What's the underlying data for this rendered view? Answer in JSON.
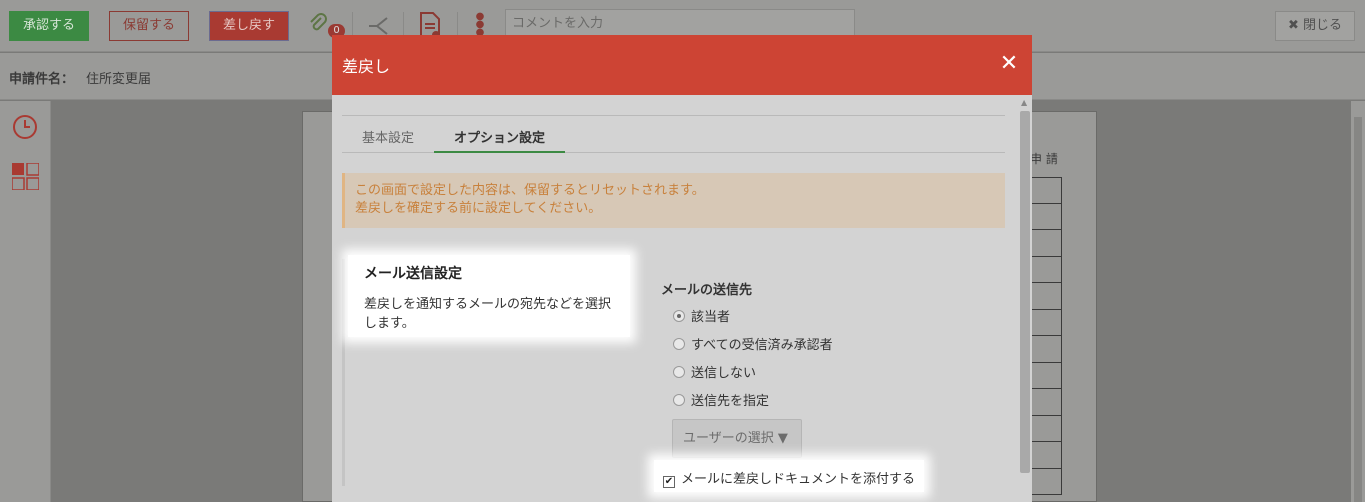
{
  "toolbar": {
    "approve_label": "承認する",
    "hold_label": "保留する",
    "return_label": "差し戻す",
    "attachment_count": "0",
    "comment_placeholder": "コメントを入力",
    "close_label": "閉じる"
  },
  "appbar": {
    "label": "申請件名：",
    "value": "住所変更届"
  },
  "paper": {
    "header_text": "申 請"
  },
  "modal": {
    "title": "差戻し",
    "tabs": [
      {
        "label": "基本設定",
        "active": false
      },
      {
        "label": "オプション設定",
        "active": true
      }
    ],
    "notice": {
      "line1": "この画面で設定した内容は、保留するとリセットされます。",
      "line2": "差戻しを確定する前に設定してください。"
    },
    "section": {
      "title": "メール送信設定",
      "description": "差戻しを通知するメールの宛先などを選択します。"
    },
    "destination": {
      "title": "メールの送信先",
      "options": [
        {
          "label": "該当者",
          "selected": true
        },
        {
          "label": "すべての受信済み承認者",
          "selected": false
        },
        {
          "label": "送信しない",
          "selected": false
        },
        {
          "label": "送信先を指定",
          "selected": false
        }
      ],
      "user_select_label": "ユーザーの選択 ▼"
    },
    "attach_checkbox": {
      "label": "メールに差戻しドキュメントを添付する",
      "checked": true
    }
  },
  "colors": {
    "modal_header": "#cd4434",
    "accent_green": "#3c8a43",
    "notice_text": "#c8813c"
  }
}
